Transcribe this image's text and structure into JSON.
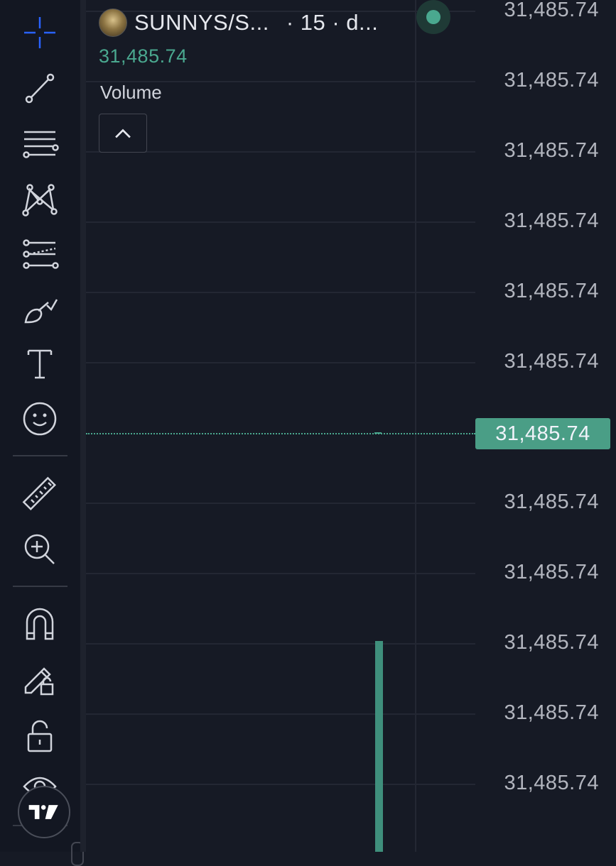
{
  "toolbar": {
    "tools": [
      {
        "name": "crosshair-icon"
      },
      {
        "name": "trend-line-icon"
      },
      {
        "name": "fib-retracement-icon"
      },
      {
        "name": "pattern-icon"
      },
      {
        "name": "prediction-icon"
      },
      {
        "name": "brush-icon"
      },
      {
        "name": "text-icon"
      },
      {
        "name": "emoji-icon"
      },
      {
        "name": "ruler-icon"
      },
      {
        "name": "zoom-in-icon"
      },
      {
        "name": "magnet-icon"
      },
      {
        "name": "lock-drawings-icon"
      },
      {
        "name": "unlock-icon"
      },
      {
        "name": "eye-icon"
      }
    ]
  },
  "legend": {
    "symbol": "SUNNYS/S...",
    "interval": "· 15 · d...",
    "last_price": "31,485.74",
    "indicator": "Volume"
  },
  "price_axis": {
    "labels": [
      "31,485.74",
      "31,485.74",
      "31,485.74",
      "31,485.74",
      "31,485.74",
      "31,485.74",
      "31,485.74",
      "31,485.74",
      "31,485.74",
      "31,485.74",
      "31,485.74",
      "31,485.74"
    ],
    "current_price": "31,485.74"
  },
  "colors": {
    "background": "#161a25",
    "accent_green": "#4aa88f",
    "grid": "#232733",
    "axis_text": "#b2b5be"
  }
}
